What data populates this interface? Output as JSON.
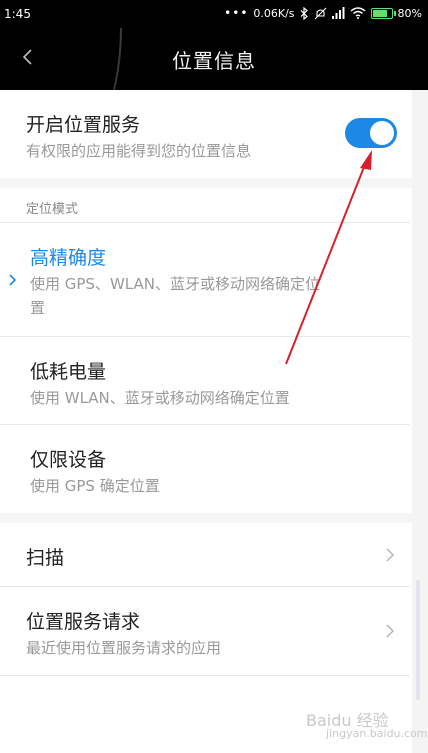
{
  "status_bar": {
    "time": "1:45",
    "network_speed": "0.06K/s",
    "battery": "80%",
    "battery_level": 0.8,
    "icons": [
      "dots-icon",
      "bluetooth-icon",
      "mute-icon",
      "signal-icon",
      "wifi-icon",
      "battery-icon"
    ]
  },
  "header": {
    "title": "位置信息",
    "back_icon": "chevron-left-icon"
  },
  "location_service": {
    "label": "开启位置服务",
    "description": "有权限的应用能得到您的位置信息",
    "enabled": true,
    "accent_color": "#1e88e5"
  },
  "mode_section": {
    "header": "定位模式",
    "options": [
      {
        "label": "高精确度",
        "description_line1": "使用 GPS、WLAN、蓝牙或移动网络确定位",
        "description_line2": "置",
        "selected": true
      },
      {
        "label": "低耗电量",
        "description": "使用 WLAN、蓝牙或移动网络确定位置",
        "selected": false
      },
      {
        "label": "仅限设备",
        "description": "使用 GPS 确定位置",
        "selected": false
      }
    ]
  },
  "scan": {
    "label": "扫描"
  },
  "requests": {
    "label": "位置服务请求",
    "description": "最近使用位置服务请求的应用"
  },
  "watermark": {
    "text": "Baidu 经验",
    "subtext": "jingyan.baidu.com"
  }
}
